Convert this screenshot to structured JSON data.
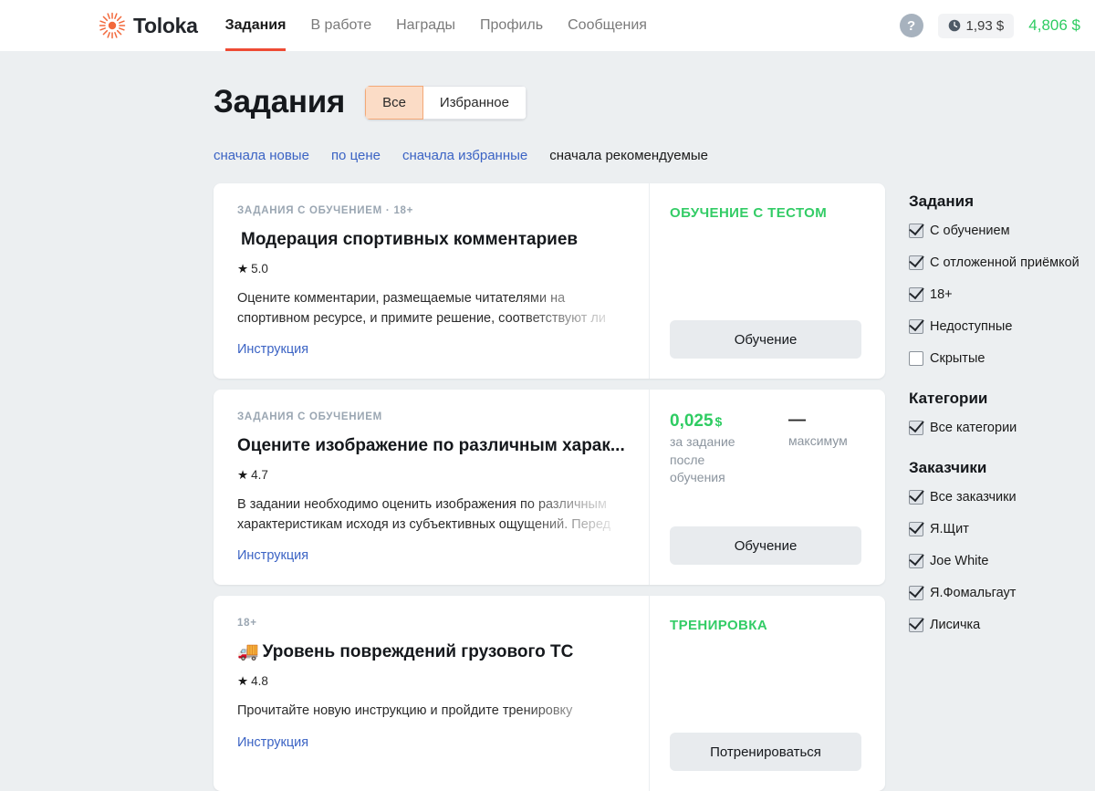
{
  "header": {
    "logo_text": "Toloka",
    "logo_icon": "toloka-sunburst-icon",
    "nav": [
      {
        "label": "Задания",
        "active": true
      },
      {
        "label": "В работе",
        "active": false
      },
      {
        "label": "Награды",
        "active": false
      },
      {
        "label": "Профиль",
        "active": false
      },
      {
        "label": "Сообщения",
        "active": false
      }
    ],
    "help_icon_label": "?",
    "pending_balance": "1,93 $",
    "pending_icon": "clock-icon",
    "main_balance": "4,806 $",
    "accent_color": "#ee4b34",
    "balance_color": "#2ecc62"
  },
  "page": {
    "title": "Задания",
    "segmented": [
      {
        "label": "Все",
        "active": true
      },
      {
        "label": "Избранное",
        "active": false
      }
    ],
    "sorts": [
      {
        "label": "сначала новые",
        "active": false
      },
      {
        "label": "по цене",
        "active": false
      },
      {
        "label": "сначала избранные",
        "active": false
      },
      {
        "label": "сначала рекомендуемые",
        "active": true
      }
    ]
  },
  "cards": [
    {
      "tag": "ЗАДАНИЯ С ОБУЧЕНИЕМ",
      "tag_sep": "·",
      "tag_extra": "18+",
      "emoji": "",
      "title": "Модерация спортивных комментариев",
      "star": "★",
      "rating": "5.0",
      "description": "Оцените комментарии, размещаемые читателями на спортивном ресурсе, и примите решение, соответствуют ли",
      "instruction": "Инструкция",
      "status": "ОБУЧЕНИЕ С ТЕСТОМ",
      "price": "",
      "currency": "",
      "price_note": "",
      "max_value": "",
      "max_note": "",
      "button": "Обучение"
    },
    {
      "tag": "ЗАДАНИЯ С ОБУЧЕНИЕМ",
      "tag_sep": "",
      "tag_extra": "",
      "emoji": "",
      "title": "Оцените изображение по различным харак...",
      "star": "★",
      "rating": "4.7",
      "description": "В задании необходимо оценить изображения по различным характеристикам исходя из субъективных ощущений. Перед",
      "instruction": "Инструкция",
      "status": "",
      "price": "0,025",
      "currency": "$",
      "price_note": "за задание после обучения",
      "max_value": "—",
      "max_note": "максимум",
      "button": "Обучение"
    },
    {
      "tag": "18+",
      "tag_sep": "",
      "tag_extra": "",
      "emoji": "🚚",
      "title": "Уровень повреждений грузового ТС",
      "star": "★",
      "rating": "4.8",
      "description": "Прочитайте новую инструкцию и пройдите тренировку",
      "instruction": "Инструкция",
      "status": "ТРЕНИРОВКА",
      "price": "",
      "currency": "",
      "price_note": "",
      "max_value": "",
      "max_note": "",
      "button": "Потренироваться"
    }
  ],
  "sidebar": [
    {
      "heading": "Задания",
      "items": [
        {
          "label": "С обучением",
          "checked": true
        },
        {
          "label": "С отложенной приёмкой",
          "checked": true
        },
        {
          "label": "18+",
          "checked": true
        },
        {
          "label": "Недоступные",
          "checked": true
        },
        {
          "label": "Скрытые",
          "checked": false
        }
      ]
    },
    {
      "heading": "Категории",
      "items": [
        {
          "label": "Все категории",
          "checked": true
        }
      ]
    },
    {
      "heading": "Заказчики",
      "items": [
        {
          "label": "Все заказчики",
          "checked": true
        },
        {
          "label": "Я.Щит",
          "checked": true
        },
        {
          "label": "Joe White",
          "checked": true
        },
        {
          "label": "Я.Фомальгаут",
          "checked": true
        },
        {
          "label": "Лисичка",
          "checked": true
        }
      ]
    }
  ]
}
